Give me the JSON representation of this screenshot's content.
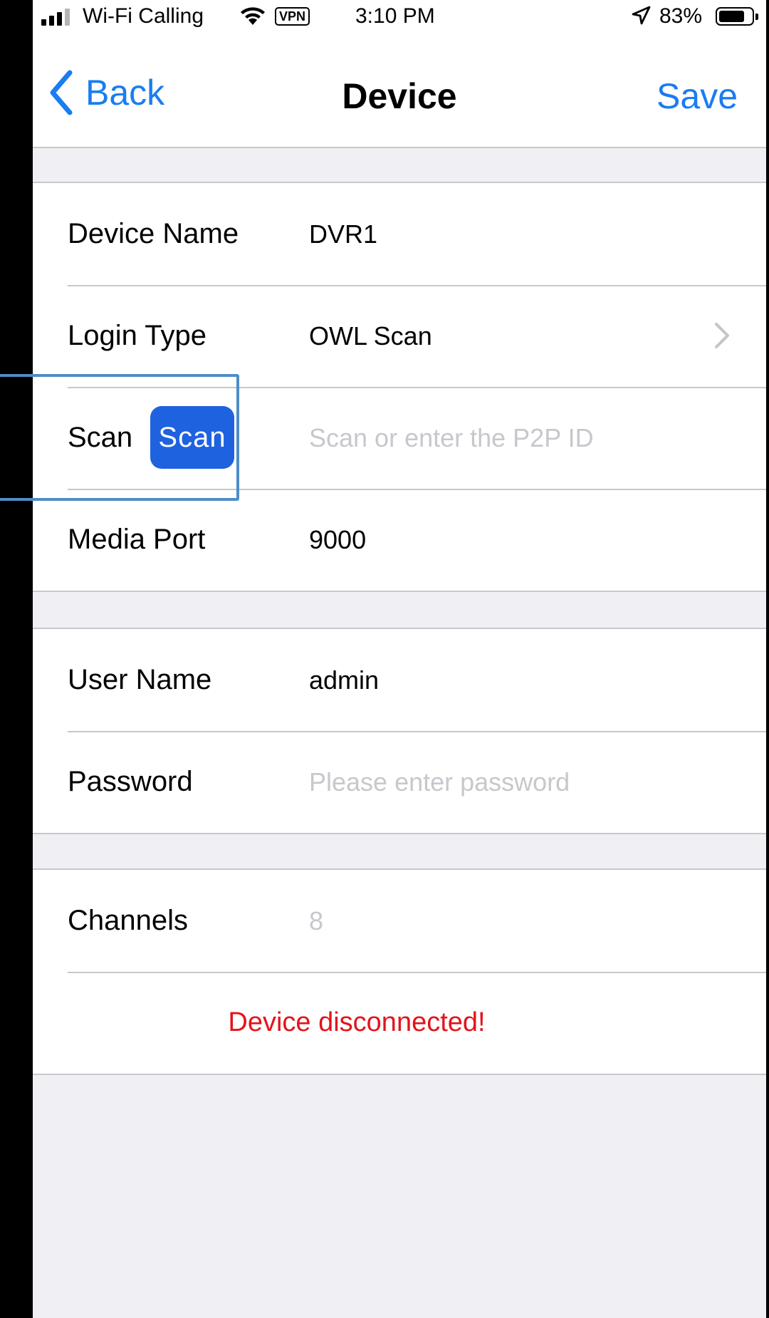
{
  "status_bar": {
    "carrier": "Wi-Fi Calling",
    "vpn": "VPN",
    "time": "3:10 PM",
    "battery_percent": "83%",
    "battery_level": 0.83,
    "signal_bars_active": 3,
    "signal_bars_total": 4,
    "icons": [
      "signal-icon",
      "wifi-icon",
      "location-arrow-icon",
      "battery-icon"
    ]
  },
  "nav": {
    "back_label": "Back",
    "title": "Device",
    "save_label": "Save",
    "accent_color": "#1a7df0"
  },
  "form": {
    "device_name": {
      "label": "Device Name",
      "value": "DVR1"
    },
    "login_type": {
      "label": "Login Type",
      "value": "OWL Scan"
    },
    "scan": {
      "label": "Scan",
      "button_label": "Scan",
      "placeholder": "Scan or enter the P2P ID"
    },
    "media_port": {
      "label": "Media Port",
      "value": "9000"
    },
    "user_name": {
      "label": "User Name",
      "value": "admin"
    },
    "password": {
      "label": "Password",
      "placeholder": "Please enter password"
    },
    "channels": {
      "label": "Channels",
      "value": "8"
    }
  },
  "error_message": "Device disconnected!",
  "error_color": "#e3141b"
}
